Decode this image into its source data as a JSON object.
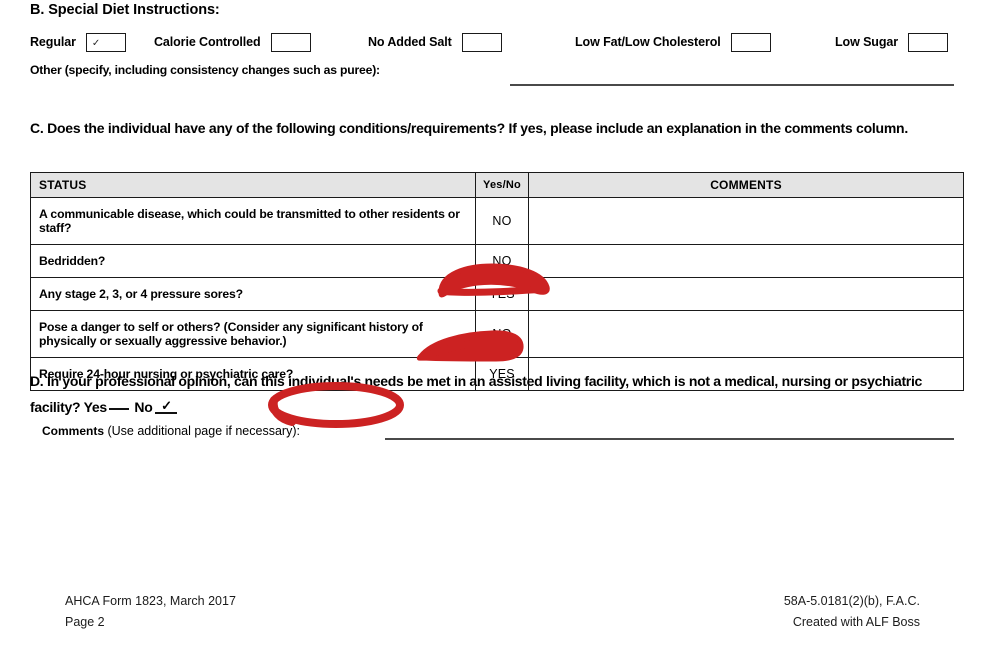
{
  "document": {
    "form_name": "AHCA Form 1823",
    "page_label": "Page 2"
  },
  "section_b": {
    "heading": "B. Special Diet Instructions:",
    "options": [
      {
        "label": "Regular",
        "checked": true,
        "check_glyph": "✓"
      },
      {
        "label": "Calorie Controlled",
        "checked": false,
        "check_glyph": ""
      },
      {
        "label": "No Added Salt",
        "checked": false,
        "check_glyph": ""
      },
      {
        "label": "Low Fat/Low Cholesterol",
        "checked": false,
        "check_glyph": ""
      },
      {
        "label": "Low Sugar",
        "checked": false,
        "check_glyph": ""
      }
    ],
    "other_label": "Other (specify, including consistency changes such as puree):",
    "other_value": ""
  },
  "section_c": {
    "heading": "C. Does the individual have any of the following conditions/requirements? If yes, please include an explanation in the comments column.",
    "columns": [
      "STATUS",
      "Yes/No",
      "COMMENTS"
    ],
    "rows": [
      {
        "status": "A communicable disease, which could be transmitted to other residents or staff?",
        "yesno": "NO",
        "comments": "",
        "annotated": false
      },
      {
        "status": "Bedridden?",
        "yesno": "NO",
        "comments": "",
        "annotated": false
      },
      {
        "status": "Any stage 2, 3, or 4 pressure sores?",
        "yesno": "YES",
        "comments": "",
        "annotated": true
      },
      {
        "status": "Pose a danger to self or others? (Consider any significant history of physically or sexually aggressive behavior.)",
        "yesno": "NO",
        "comments": "",
        "annotated": false
      },
      {
        "status": "Require 24-hour nursing or psychiatric care?",
        "yesno": "YES",
        "comments": "",
        "annotated": true
      }
    ]
  },
  "section_d": {
    "heading_part1": "D. In your professional opinion, can this individual's needs be met in an assisted living facility, which is not a medical, nursing or psychiatric facility?",
    "yes_label": "Yes",
    "yes_mark": "",
    "no_label": "No",
    "no_mark": "✓",
    "comments_label_bold": "Comments",
    "comments_label_rest": " (Use additional page if necessary):",
    "comments_value": ""
  },
  "footer": {
    "left_line1": "AHCA Form 1823, March 2017",
    "left_line2": "Page 2",
    "right_line1": "58A-5.0181(2)(b), F.A.C.",
    "right_line2": "Created with ALF Boss"
  },
  "annotation": {
    "color": "#cc2222",
    "marks": [
      {
        "name": "circle-pressure-sores-yes",
        "shape": "ellipse"
      },
      {
        "name": "circle-24-hour-care-yes",
        "shape": "ellipse"
      },
      {
        "name": "circle-section-d-answer",
        "shape": "ellipse"
      }
    ]
  }
}
